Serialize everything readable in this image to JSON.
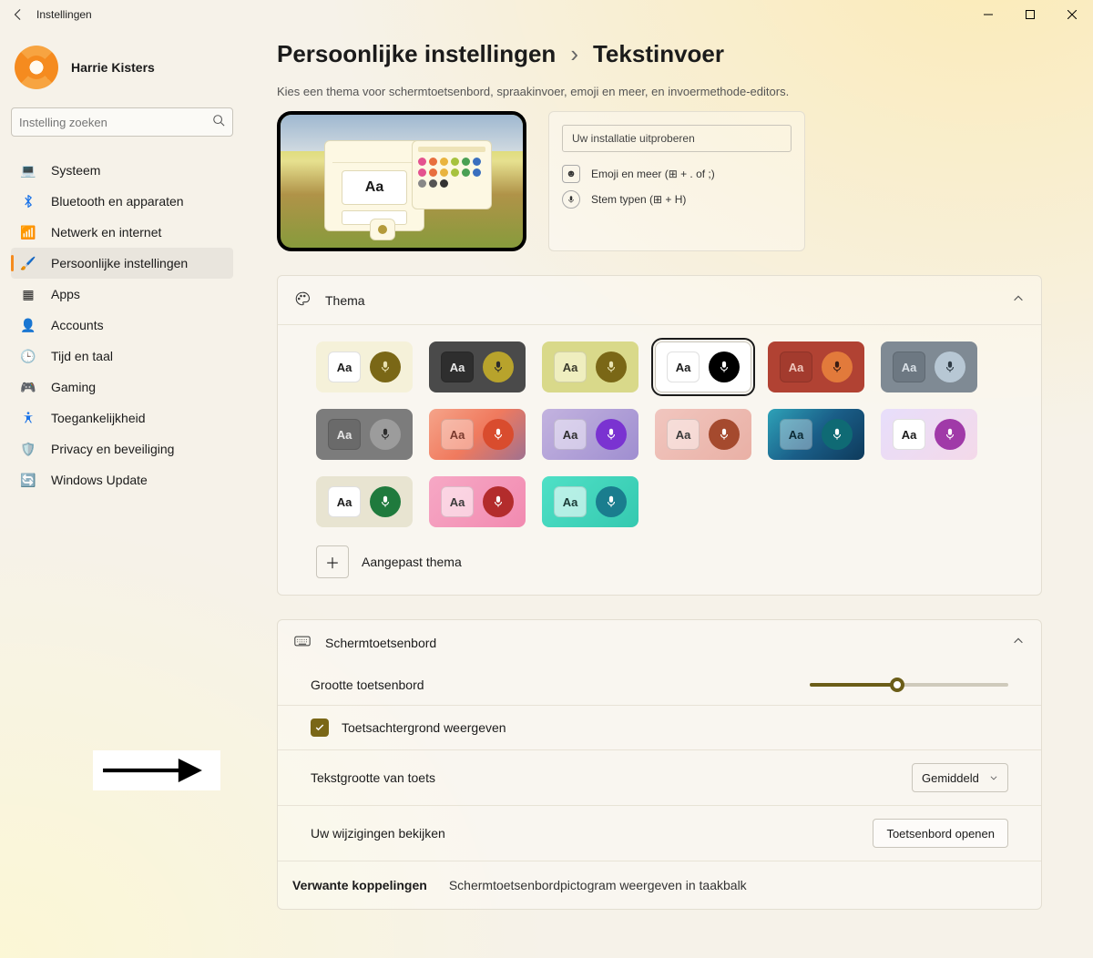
{
  "window": {
    "title": "Instellingen"
  },
  "user": {
    "name": "Harrie Kisters"
  },
  "search": {
    "placeholder": "Instelling zoeken"
  },
  "sidebar": {
    "items": [
      {
        "label": "Systeem",
        "icon": "💻",
        "active": false
      },
      {
        "label": "Bluetooth en apparaten",
        "icon": "bt",
        "active": false
      },
      {
        "label": "Netwerk en internet",
        "icon": "📶",
        "active": false
      },
      {
        "label": "Persoonlijke instellingen",
        "icon": "🖌️",
        "active": true
      },
      {
        "label": "Apps",
        "icon": "▦",
        "active": false
      },
      {
        "label": "Accounts",
        "icon": "👤",
        "active": false
      },
      {
        "label": "Tijd en taal",
        "icon": "🕒",
        "active": false
      },
      {
        "label": "Gaming",
        "icon": "🎮",
        "active": false
      },
      {
        "label": "Toegankelijkheid",
        "icon": "acc",
        "active": false
      },
      {
        "label": "Privacy en beveiliging",
        "icon": "🛡️",
        "active": false
      },
      {
        "label": "Windows Update",
        "icon": "🔄",
        "active": false
      }
    ]
  },
  "breadcrumb": {
    "cat": "Persoonlijke instellingen",
    "page": "Tekstinvoer"
  },
  "subhead": "Kies een thema voor schermtoetsenbord, spraakinvoer, emoji en meer, en invoermethode-editors.",
  "try": {
    "placeholder": "Uw installatie uitproberen",
    "emoji": "Emoji en meer (⊞ + . of ;)",
    "voice": "Stem typen (⊞ + H)"
  },
  "preview": {
    "aa": "Aa"
  },
  "theme_section": {
    "title": "Thema",
    "custom_label": "Aangepast thema"
  },
  "themes": [
    {
      "bg": "#f5f1d9",
      "aa_bg": "#ffffff",
      "aa_fg": "#1b1b1b",
      "mic_bg": "#7a6716",
      "mic_fg": "#e9e1b1",
      "selected": false
    },
    {
      "bg": "#4a4a4a",
      "aa_bg": "#2e2e2e",
      "aa_fg": "#eaeaea",
      "mic_bg": "#b8a32c",
      "mic_fg": "#2b2b2b",
      "selected": false
    },
    {
      "bg": "#d9d98a",
      "aa_bg": "#efeebf",
      "aa_fg": "#3a3a2c",
      "mic_bg": "#7a6716",
      "mic_fg": "#e9e4b3",
      "selected": false
    },
    {
      "bg": "#ffffff",
      "aa_bg": "#ffffff",
      "aa_fg": "#1b1b1b",
      "mic_bg": "#000000",
      "mic_fg": "#ffffff",
      "selected": true
    },
    {
      "bg": "#b14233",
      "aa_bg": "#a33b2e",
      "aa_fg": "#efc7bd",
      "mic_bg": "#e27a3b",
      "mic_fg": "#3b1c12",
      "selected": false
    },
    {
      "bg": "#7f8a94",
      "aa_bg": "#6d7882",
      "aa_fg": "#d9e0e6",
      "mic_bg": "#b7c7d4",
      "mic_fg": "#2e3a44",
      "selected": false
    },
    {
      "bg": "#7c7c7c",
      "aa_bg": "#6a6a6a",
      "aa_fg": "#e6e6e6",
      "mic_bg": "#9c9c9c",
      "mic_fg": "#2c2c2c",
      "selected": false
    },
    {
      "bg": "linear-gradient(135deg,#f5a48a,#f07a5e,#a0718f)",
      "aa_bg": "rgba(255,255,255,0.35)",
      "aa_fg": "#7a3a2e",
      "mic_bg": "#d94c2e",
      "mic_fg": "#ffffff",
      "selected": false
    },
    {
      "bg": "linear-gradient(135deg,#c3b3df,#9f8ed0)",
      "aa_bg": "rgba(255,255,255,0.45)",
      "aa_fg": "#2e2e2e",
      "mic_bg": "#7a33d1",
      "mic_fg": "#ffffff",
      "selected": false
    },
    {
      "bg": "linear-gradient(135deg,#f1c6bf,#e9b0a5)",
      "aa_bg": "rgba(255,255,255,0.45)",
      "aa_fg": "#3a3a3a",
      "mic_bg": "#a54a2e",
      "mic_fg": "#ffffff",
      "selected": false
    },
    {
      "bg": "linear-gradient(135deg,#2ea2b8,#1a5e88,#0e3a5b)",
      "aa_bg": "rgba(255,255,255,0.35)",
      "aa_fg": "#0c2a34",
      "mic_bg": "#0f6a74",
      "mic_fg": "#ffffff",
      "selected": false
    },
    {
      "bg": "linear-gradient(135deg,#e7defb,#f4d9e9)",
      "aa_bg": "#ffffff",
      "aa_fg": "#1b1b1b",
      "mic_bg": "#a03aa8",
      "mic_fg": "#ffffff",
      "selected": false
    },
    {
      "bg": "#e8e4d1",
      "aa_bg": "#ffffff",
      "aa_fg": "#1b1b1b",
      "mic_bg": "#1f7a3d",
      "mic_fg": "#ffffff",
      "selected": false
    },
    {
      "bg": "linear-gradient(135deg,#f6a8c5,#f28ab0)",
      "aa_bg": "rgba(255,255,255,0.55)",
      "aa_fg": "#3a3a3a",
      "mic_bg": "#b32c2c",
      "mic_fg": "#ffffff",
      "selected": false
    },
    {
      "bg": "linear-gradient(135deg,#4fe0c6,#35c9b0)",
      "aa_bg": "rgba(255,255,255,0.6)",
      "aa_fg": "#1b3a36",
      "mic_bg": "#1a7d8e",
      "mic_fg": "#ffffff",
      "selected": false
    }
  ],
  "keyboard_section": {
    "title": "Schermtoetsenbord",
    "size_label": "Grootte toetsenbord",
    "size_value": 44,
    "show_bg_label": "Toetsachtergrond weergeven",
    "show_bg_checked": true,
    "text_size_label": "Tekstgrootte van toets",
    "text_size_value": "Gemiddeld",
    "review_label": "Uw wijzigingen bekijken",
    "open_btn": "Toetsenbord openen"
  },
  "related": {
    "title": "Verwante koppelingen",
    "link": "Schermtoetsenbordpictogram weergeven in taakbalk"
  },
  "aa": "Aa"
}
